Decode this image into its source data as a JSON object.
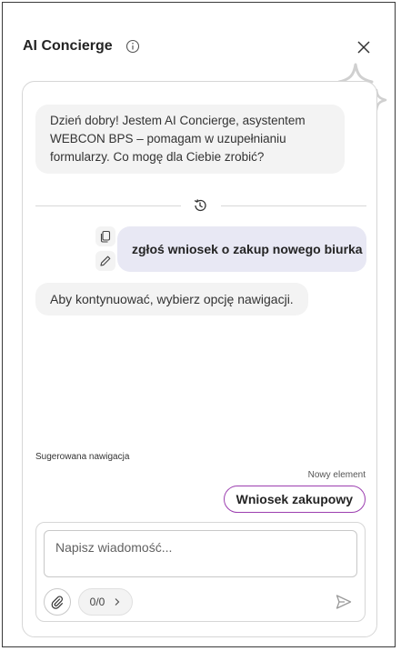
{
  "panel": {
    "title": "AI Concierge",
    "icons": {
      "info": "info-icon",
      "close": "close-icon",
      "sparkle": "sparkle-icon"
    }
  },
  "conversation": {
    "bot_greeting": "Dzień dobry! Jestem AI Concierge, asystentem WEBCON BPS – pomagam w uzupełnianiu formularzy. Co mogę dla Ciebie zrobić?",
    "history_icon": "history-icon",
    "user_message": "zgłoś wniosek o zakup nowego biurka",
    "message_actions": [
      "copy-icon",
      "edit-icon"
    ],
    "bot_reply": "Aby kontynuować, wybierz opcję nawigacji."
  },
  "suggestions": {
    "label": "Sugerowana nawigacja",
    "item_label": "Nowy element",
    "item_button": "Wniosek zakupowy"
  },
  "composer": {
    "placeholder": "Napisz wiadomość...",
    "counter": "0/0",
    "icons": {
      "attach": "paperclip-icon",
      "counter_next": "chevron-right-icon",
      "send": "send-icon"
    }
  },
  "colors": {
    "accent_border": "#9c3fb0",
    "user_bubble": "#e8e8f4",
    "bot_bubble": "#f3f3f3"
  }
}
